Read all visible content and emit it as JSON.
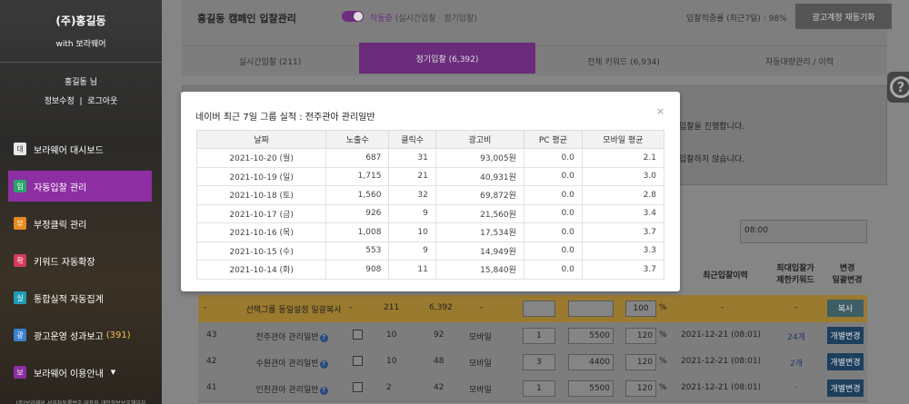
{
  "sidebar": {
    "brand": "(주)홍길동",
    "brand_sub": "with 보라웨어",
    "user": "홍길동 님",
    "edit": "정보수정",
    "sep": "|",
    "logout": "로그아웃",
    "items": [
      {
        "icon": "대",
        "label": "보라웨어 대시보드",
        "color": "#e8e8e8",
        "text_color": "#333"
      },
      {
        "icon": "입",
        "label": "자동입찰 관리",
        "color": "#27a56c",
        "text_color": "#fff"
      },
      {
        "icon": "부",
        "label": "부정클릭 관리",
        "color": "#e58a1f",
        "text_color": "#fff"
      },
      {
        "icon": "확",
        "label": "키워드 자동확장",
        "color": "#d43b5a",
        "text_color": "#fff"
      },
      {
        "icon": "실",
        "label": "통합실적 자동집계",
        "color": "#1f9bb5",
        "text_color": "#fff"
      },
      {
        "icon": "광",
        "label": "광고운영 성과보고",
        "count": "(391)",
        "color": "#3a7fd0",
        "text_color": "#fff"
      },
      {
        "icon": "보",
        "label": "보라웨어 이용안내",
        "color": "#8e2ea3",
        "text_color": "#fff"
      }
    ],
    "bottom_text": "(주)보라웨어 사업자등록번호 대표자 개인정보보호책임자"
  },
  "header": {
    "title": "홍길동 캠페인 입찰관리",
    "toggle_state": "작동중",
    "toggle_desc": "(실시간입찰 · 정기입찰)",
    "rate": "입찰적중률 (최근7일) : 98%",
    "reload": "광고계정 재동기화"
  },
  "tabs": [
    {
      "label": "실시간입찰 (211)"
    },
    {
      "label": "정기입찰 (6,392)"
    },
    {
      "label": "전체 키워드 (6,934)"
    },
    {
      "label": "자동대량관리 / 이력"
    }
  ],
  "panel": {
    "line1": "입찰을 진행합니다.",
    "line2": "입찰하지 않습니다.",
    "time": "08:00"
  },
  "table": {
    "col_last": "최근입찰이력",
    "col_max": "최대입찰가\n제한키워드",
    "col_change": "변경\n일괄변경",
    "bulk_row": {
      "dash": "-",
      "label": "선택그룹 동일설정 일괄복사",
      "dash2": "-",
      "n1": "211",
      "n2": "6,392",
      "dash3": "-",
      "pct": "100",
      "pct_sign": "%",
      "dash4": "-",
      "dash5": "-",
      "btn": "복사"
    },
    "rows": [
      {
        "no": "43",
        "name": "전주관아 관리일반",
        "n1": "10",
        "n2": "92",
        "device": "모바일",
        "rank": "1",
        "bid": "5500",
        "pct": "120",
        "pct_sign": "%",
        "last": "2021-12-21 (08:01)",
        "max": "24개",
        "btn": "개별변경"
      },
      {
        "no": "42",
        "name": "수원관아 관리일반",
        "n1": "10",
        "n2": "48",
        "device": "모바일",
        "rank": "3",
        "bid": "4400",
        "pct": "120",
        "pct_sign": "%",
        "last": "2021-12-21 (08:01)",
        "max": "2개",
        "btn": "개별변경"
      },
      {
        "no": "41",
        "name": "인천관아 관리일반",
        "n1": "2",
        "n2": "42",
        "device": "모바일",
        "rank": "1",
        "bid": "5500",
        "pct": "120",
        "pct_sign": "%",
        "last": "2021-12-21 (08:01)",
        "max": "-",
        "btn": "개별변경"
      }
    ]
  },
  "help_icon": "?",
  "modal": {
    "title": "네이버 최근 7일 그룹 실적 : 전주관아 관리일반",
    "close": "×",
    "columns": [
      "날짜",
      "노출수",
      "클릭수",
      "광고비",
      "PC 평균",
      "모바일 평균"
    ],
    "rows": [
      [
        "2021-10-20 (월)",
        "687",
        "31",
        "93,005원",
        "0.0",
        "2.1"
      ],
      [
        "2021-10-19 (일)",
        "1,715",
        "21",
        "40,931원",
        "0.0",
        "3.0"
      ],
      [
        "2021-10-18 (토)",
        "1,560",
        "32",
        "69,872원",
        "0.0",
        "2.8"
      ],
      [
        "2021-10-17 (금)",
        "926",
        "9",
        "21,560원",
        "0.0",
        "3.4"
      ],
      [
        "2021-10-16 (목)",
        "1,008",
        "10",
        "17,534원",
        "0.0",
        "3.7"
      ],
      [
        "2021-10-15 (수)",
        "553",
        "9",
        "14,949원",
        "0.0",
        "3.3"
      ],
      [
        "2021-10-14 (화)",
        "908",
        "11",
        "15,840원",
        "0.0",
        "3.7"
      ]
    ]
  }
}
